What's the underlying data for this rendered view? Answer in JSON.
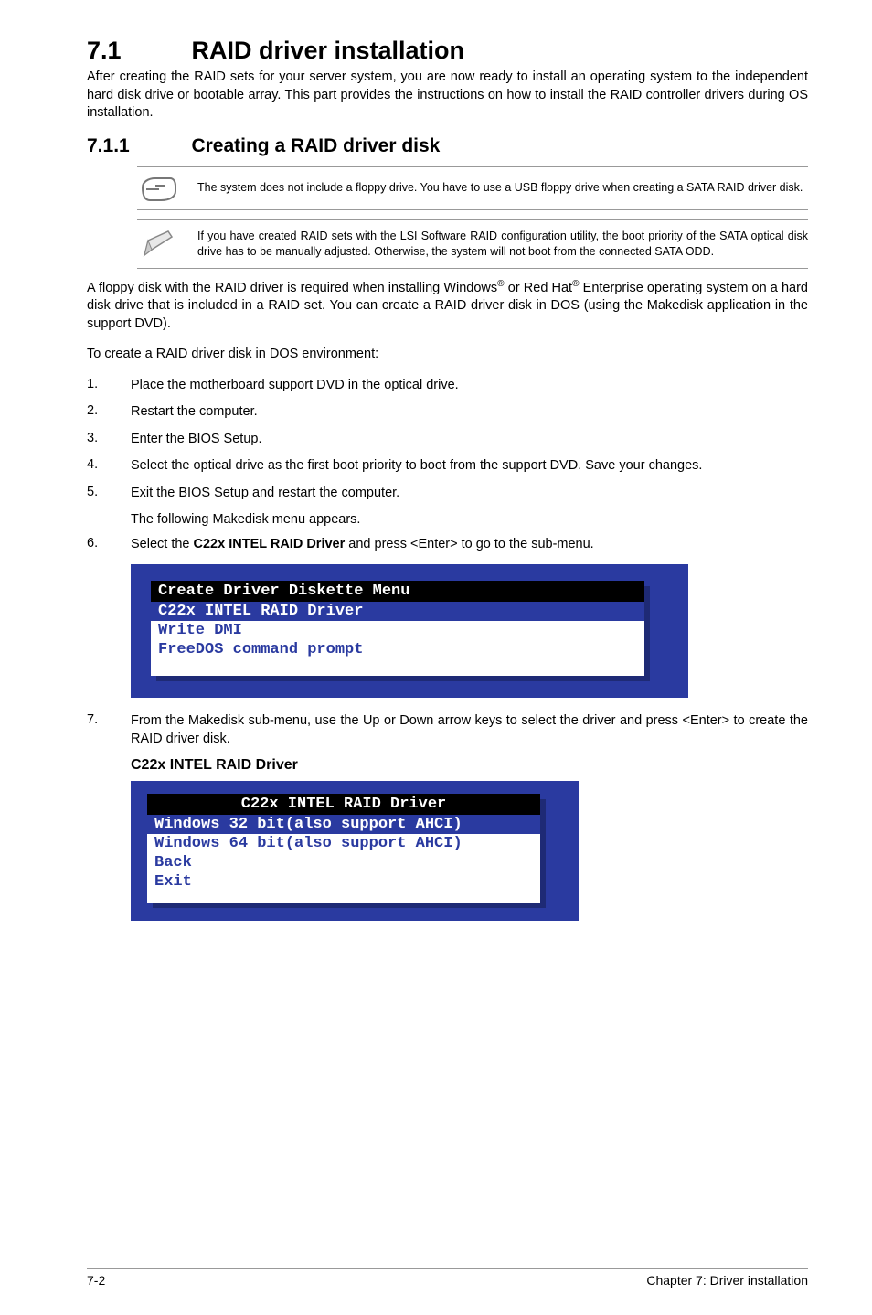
{
  "section": {
    "number": "7.1",
    "title": "RAID driver installation",
    "intro": "After creating the RAID sets for your server system, you are now ready to install an operating system to the independent hard disk drive or bootable array. This part provides the instructions on how to install the RAID controller drivers during OS installation."
  },
  "subsection": {
    "number": "7.1.1",
    "title": "Creating a RAID driver disk"
  },
  "note1": "The system does not include a floppy drive. You have to use a USB floppy drive when creating a SATA RAID driver disk.",
  "note2": "If you have created RAID sets with the LSI Software RAID configuration utility, the boot priority of the SATA optical disk drive has to be manually adjusted. Otherwise, the system will not boot from the connected SATA ODD.",
  "para_after_notes_pre": "A floppy disk with the RAID driver is required when installing Windows",
  "para_after_notes_mid": " or Red Hat",
  "para_after_notes_post": " Enterprise operating system on a hard disk drive that is included in a RAID set. You can create a RAID driver disk in DOS (using the Makedisk application in the support DVD).",
  "para_env": "To create a RAID driver disk in DOS environment:",
  "steps": [
    {
      "n": "1.",
      "t": "Place the motherboard support DVD in the optical drive."
    },
    {
      "n": "2.",
      "t": "Restart the computer."
    },
    {
      "n": "3.",
      "t": "Enter the BIOS Setup."
    },
    {
      "n": "4.",
      "t": "Select the optical drive as the first boot priority to boot from the support DVD. Save your changes."
    },
    {
      "n": "5.",
      "t": "Exit the BIOS Setup and restart the computer."
    }
  ],
  "step5_sub": "The following Makedisk menu appears.",
  "step6_pre": "Select the ",
  "step6_bold": "C22x INTEL RAID Driver",
  "step6_post": " and press <Enter> to go to the sub-menu.",
  "step6_n": "6.",
  "menu1": {
    "title": "Create Driver Diskette Menu",
    "selected": "C22x INTEL RAID Driver",
    "items": [
      "Write DMI",
      "FreeDOS command prompt"
    ]
  },
  "step7_n": "7.",
  "step7": "From the Makedisk sub-menu, use the Up or Down arrow keys to select the driver and press <Enter> to create the RAID driver disk.",
  "sub_heading": "C22x INTEL RAID Driver",
  "menu2": {
    "title": "C22x INTEL RAID Driver",
    "selected": "Windows 32 bit(also support AHCI)",
    "items": [
      "Windows 64 bit(also support AHCI)",
      "Back",
      "Exit"
    ]
  },
  "footer": {
    "left": "7-2",
    "right": "Chapter 7: Driver installation"
  }
}
